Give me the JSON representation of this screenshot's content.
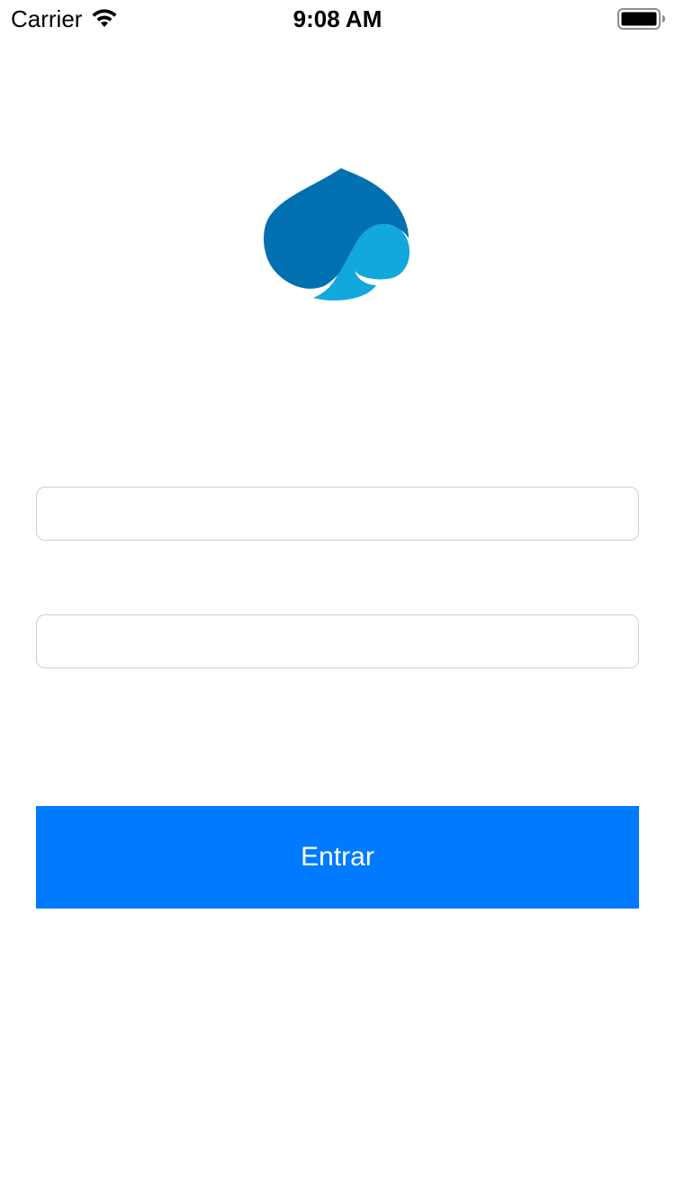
{
  "status_bar": {
    "carrier": "Carrier",
    "time": "9:08 AM",
    "icons": [
      "wifi-icon",
      "battery-icon"
    ]
  },
  "logo": {
    "icon": "drop-logo-icon",
    "colors": {
      "dark": "#0070b0",
      "light": "#12a8dc"
    }
  },
  "form": {
    "username": {
      "value": "",
      "placeholder": ""
    },
    "password": {
      "value": "",
      "placeholder": ""
    },
    "submit_label": "Entrar"
  },
  "colors": {
    "accent": "#007aff",
    "field_border": "#cfcfcf",
    "background": "#ffffff"
  }
}
